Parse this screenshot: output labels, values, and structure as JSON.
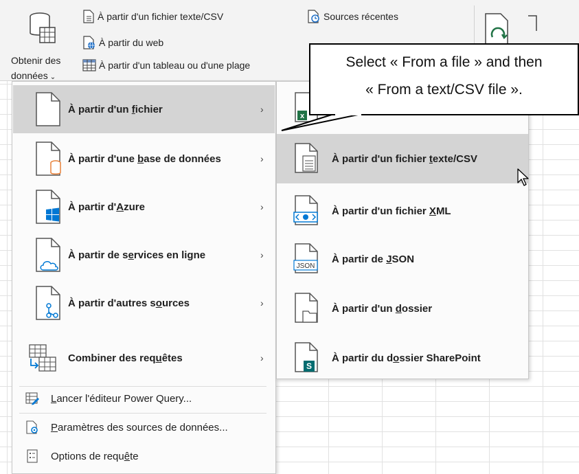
{
  "ribbon": {
    "get_data_line1": "Obtenir des",
    "get_data_line2": "données",
    "items": [
      {
        "label": "À partir d'un fichier texte/CSV",
        "icon": "text-file-icon"
      },
      {
        "label": "À partir du web",
        "icon": "web-file-icon"
      },
      {
        "label": "À partir d'un tableau ou d'une plage",
        "icon": "table-range-icon"
      },
      {
        "label": "Sources récentes",
        "icon": "recent-sources-icon"
      }
    ]
  },
  "main_menu": {
    "rows": [
      {
        "pre": "À partir d'un ",
        "u": "f",
        "post": "ichier",
        "icon": "file-icon",
        "active": true
      },
      {
        "pre": "À partir d'une ",
        "u": "b",
        "post": "ase de données",
        "icon": "database-file-icon"
      },
      {
        "pre": "À partir d'",
        "u": "A",
        "post": "zure",
        "icon": "azure-file-icon"
      },
      {
        "pre": "À partir de s",
        "u": "e",
        "post": "rvices en ligne",
        "icon": "cloud-file-icon"
      },
      {
        "pre": "À partir d'autres s",
        "u": "o",
        "post": "urces",
        "icon": "other-sources-icon"
      },
      {
        "pre": "Combiner des req",
        "u": "u",
        "post": "êtes",
        "icon": "combine-queries-icon"
      }
    ],
    "small_rows": [
      {
        "pre": "",
        "u": "L",
        "post": "ancer l'éditeur Power Query...",
        "icon": "power-query-editor-icon"
      },
      {
        "pre": "",
        "u": "P",
        "post": "aramètres des sources de données...",
        "icon": "data-source-settings-icon"
      },
      {
        "pre": "Options de requ",
        "u": "ê",
        "post": "te",
        "icon": "query-options-icon"
      }
    ],
    "arrow": "›"
  },
  "sub_menu": {
    "rows": [
      {
        "pre": "À partir d'un fichier ",
        "u": "t",
        "post": "exte/CSV",
        "icon": "text-csv-file-icon",
        "active": true
      },
      {
        "pre": "À partir d'un fichier ",
        "u": "X",
        "post": "ML",
        "icon": "xml-file-icon"
      },
      {
        "pre": "À partir de ",
        "u": "J",
        "post": "SON",
        "icon": "json-file-icon"
      },
      {
        "pre": "À partir d'un ",
        "u": "d",
        "post": "ossier",
        "icon": "folder-file-icon"
      },
      {
        "pre": "À partir du d",
        "u": "o",
        "post": "ssier SharePoint",
        "icon": "sharepoint-folder-icon"
      }
    ]
  },
  "callout": {
    "line1": "Select « From a file » and then",
    "line2": "« From a text/CSV file »."
  },
  "colors": {
    "excel_green": "#217346",
    "azure_blue": "#0078d4",
    "database_orange": "#e8823b",
    "sharepoint_teal": "#036c70",
    "highlight": "#d4d4d4"
  }
}
